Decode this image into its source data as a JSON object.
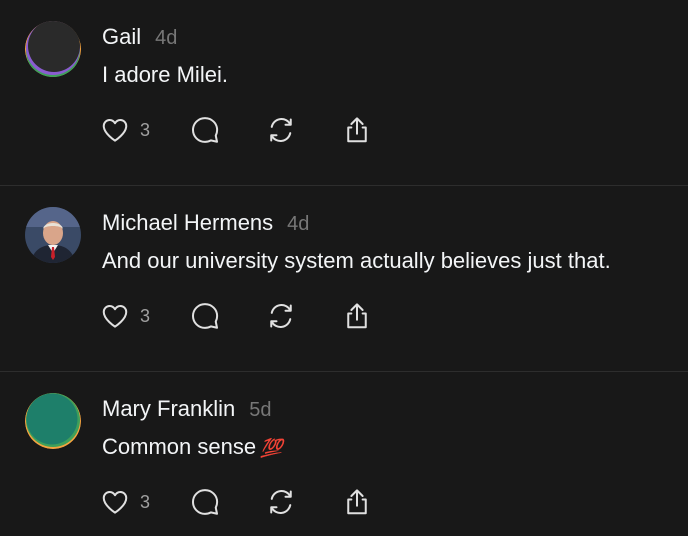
{
  "posts": [
    {
      "author": "Gail",
      "time": "4d",
      "text": "I adore Milei.",
      "emoji": "",
      "likes": "3",
      "avatar": {
        "kind": "abstract",
        "colors": [
          "#2a2a2a",
          "#f4a340",
          "#3fa05a",
          "#8a5cd0"
        ]
      },
      "icons": [
        "heart-icon",
        "comment-icon",
        "repost-icon",
        "share-icon"
      ]
    },
    {
      "author": "Michael Hermens",
      "time": "4d",
      "text": "And our university system actually believes just that.",
      "emoji": "",
      "likes": "3",
      "avatar": {
        "kind": "photo",
        "colors": [
          "#3a4a66",
          "#d9a58a",
          "#1f2533",
          "#c8202a"
        ]
      },
      "icons": [
        "heart-icon",
        "comment-icon",
        "repost-icon",
        "share-icon"
      ]
    },
    {
      "author": "Mary Franklin",
      "time": "5d",
      "text": "Common sense",
      "emoji": "💯",
      "likes": "3",
      "avatar": {
        "kind": "abstract",
        "colors": [
          "#1e7f6a",
          "#f4a340",
          "#3fa05a"
        ]
      },
      "icons": [
        "heart-icon",
        "comment-icon",
        "repost-icon",
        "share-icon"
      ]
    }
  ],
  "theme": {
    "background": "#181818",
    "text": "#f3f5f7",
    "muted": "#777777",
    "divider": "#2d2d2d"
  }
}
